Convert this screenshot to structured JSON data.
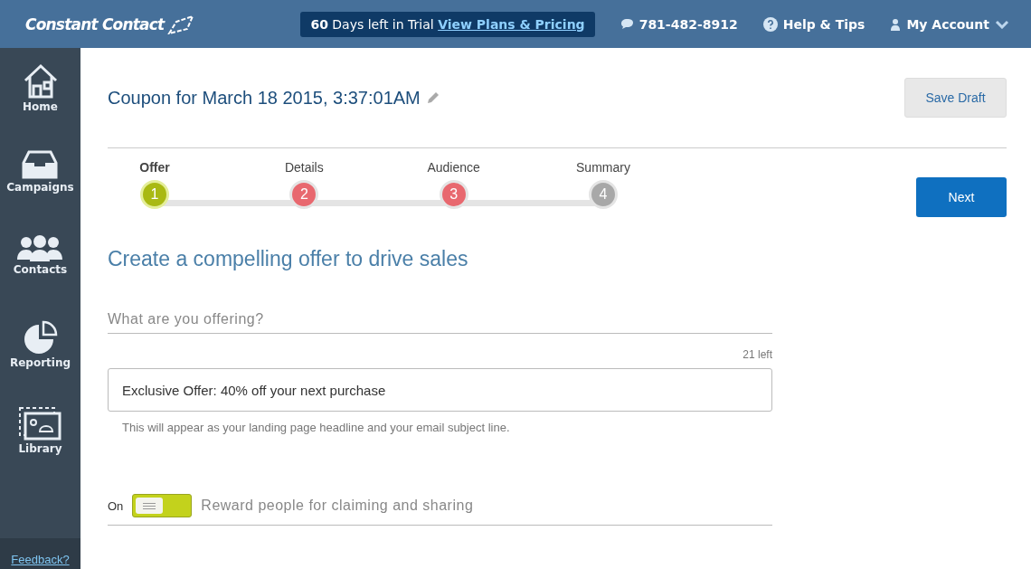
{
  "header": {
    "logo": "Constant Contact",
    "trial": {
      "days": "60",
      "text": "Days left in Trial",
      "link": "View Plans & Pricing"
    },
    "phone": "781-482-8912",
    "help": "Help & Tips",
    "account": "My Account"
  },
  "sidebar": {
    "items": [
      {
        "kind": "home",
        "label": "Home"
      },
      {
        "kind": "campaigns",
        "label": "Campaigns"
      },
      {
        "kind": "contacts",
        "label": "Contacts"
      },
      {
        "kind": "reporting",
        "label": "Reporting"
      },
      {
        "kind": "library",
        "label": "Library"
      }
    ],
    "feedback": "Feedback?"
  },
  "title": "Coupon for March 18 2015, 3:37:01AM",
  "save_button": "Save Draft",
  "next_button": "Next",
  "steps": [
    {
      "label": "Offer",
      "number": "1",
      "selected": true,
      "kind": "current"
    },
    {
      "label": "Details",
      "number": "2",
      "selected": false,
      "kind": "error"
    },
    {
      "label": "Audience",
      "number": "3",
      "selected": false,
      "kind": "error"
    },
    {
      "label": "Summary",
      "number": "4",
      "selected": false,
      "kind": "pending"
    }
  ],
  "heading": "Create a compelling offer to drive sales",
  "offer_field": {
    "label": "What are you offering?",
    "counter": "21 left",
    "value": "Exclusive Offer: 40% off your next purchase",
    "hint": "This will appear as your landing page headline and your email subject line."
  },
  "reward": {
    "state_label": "On",
    "on": true,
    "label": "Reward people for claiming and sharing"
  }
}
